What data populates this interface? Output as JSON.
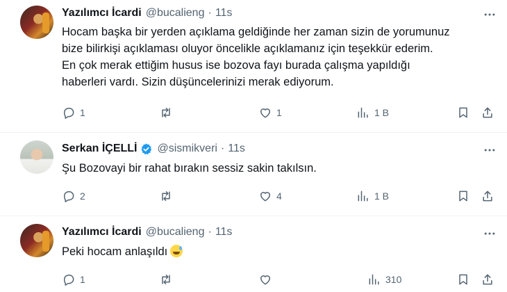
{
  "tweets": [
    {
      "name": "Yazılımcı İcardi",
      "handle": "@bucalieng",
      "separator": "·",
      "time": "11s",
      "verified": false,
      "text_lines": [
        "Hocam başka bir yerden açıklama geldiğinde her zaman sizin de yorumunuz",
        "bize bilirkişi açıklaması oluyor  öncelikle açıklamanız için teşekkür ederim.",
        "En çok merak ettiğim husus ise bozova fayı burada çalışma yapıldığı",
        "haberleri vardı. Sizin düşüncelerinizi merak ediyorum."
      ],
      "replies": "1",
      "retweets": "",
      "likes": "1",
      "views": "1 B"
    },
    {
      "name": "Serkan İÇELLİ",
      "handle": "@sismikveri",
      "separator": "·",
      "time": "11s",
      "verified": true,
      "text_lines": [
        "Şu Bozovayi bir rahat bırakın sessiz sakin takılsın."
      ],
      "replies": "2",
      "retweets": "",
      "likes": "4",
      "views": "1 B"
    },
    {
      "name": "Yazılımcı İcardi",
      "handle": "@bucalieng",
      "separator": "·",
      "time": "11s",
      "verified": false,
      "text_lines": [
        "Peki hocam anlaşıldı"
      ],
      "emoji": "grinning-sweat-emoji",
      "replies": "1",
      "retweets": "",
      "likes": "",
      "views": "310"
    }
  ],
  "icons": [
    "more-icon",
    "reply-icon",
    "retweet-icon",
    "like-icon",
    "views-icon",
    "bookmark-icon",
    "share-icon",
    "verified-badge-icon"
  ],
  "colors": {
    "text": "#0f1419",
    "secondary": "#536471",
    "verified": "#1d9bf0",
    "divider": "#eff3f4"
  }
}
